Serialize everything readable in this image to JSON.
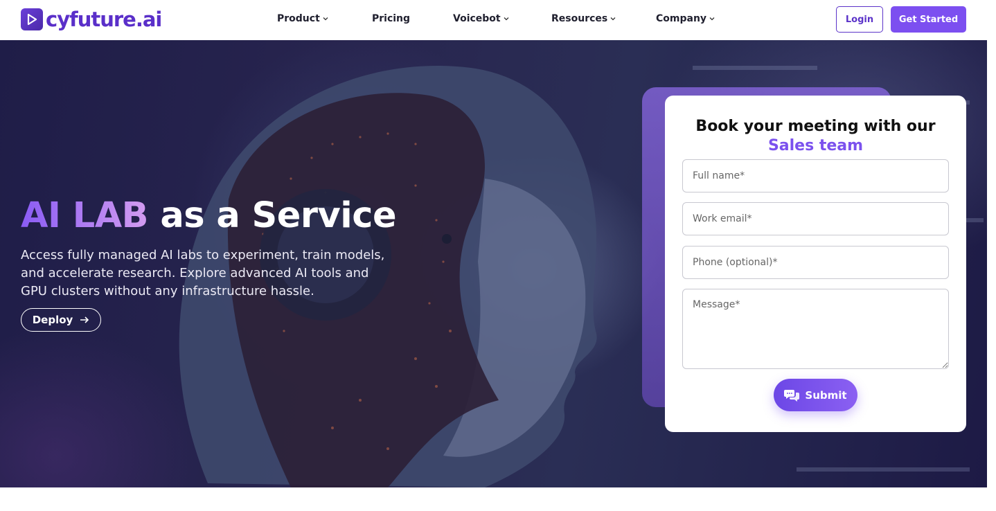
{
  "brand": {
    "name": "cyfuture.ai",
    "icon": "play-icon",
    "color": "#5a2fc9"
  },
  "nav": {
    "items": [
      {
        "label": "Product",
        "has_dropdown": true
      },
      {
        "label": "Pricing",
        "has_dropdown": false
      },
      {
        "label": "Voicebot",
        "has_dropdown": true
      },
      {
        "label": "Resources",
        "has_dropdown": true
      },
      {
        "label": "Company",
        "has_dropdown": true
      }
    ],
    "login_label": "Login",
    "get_started_label": "Get Started"
  },
  "hero": {
    "headline_highlight": "AI LAB",
    "headline_rest": "as a Service",
    "description": "Access fully managed AI labs to experiment, train models, and accelerate research. Explore advanced AI tools and GPU clusters without any infrastructure hassle.",
    "deploy_label": "Deploy"
  },
  "form": {
    "title": "Book your meeting with our",
    "title_highlight": "Sales team",
    "full_name_placeholder": "Full name*",
    "email_placeholder": "Work email*",
    "phone_placeholder": "Phone (optional)*",
    "message_placeholder": "Message*",
    "submit_label": "Submit"
  },
  "colors": {
    "accent": "#7c4ff0",
    "hero_bg": "#24224d",
    "highlight": "#7b51ee"
  }
}
